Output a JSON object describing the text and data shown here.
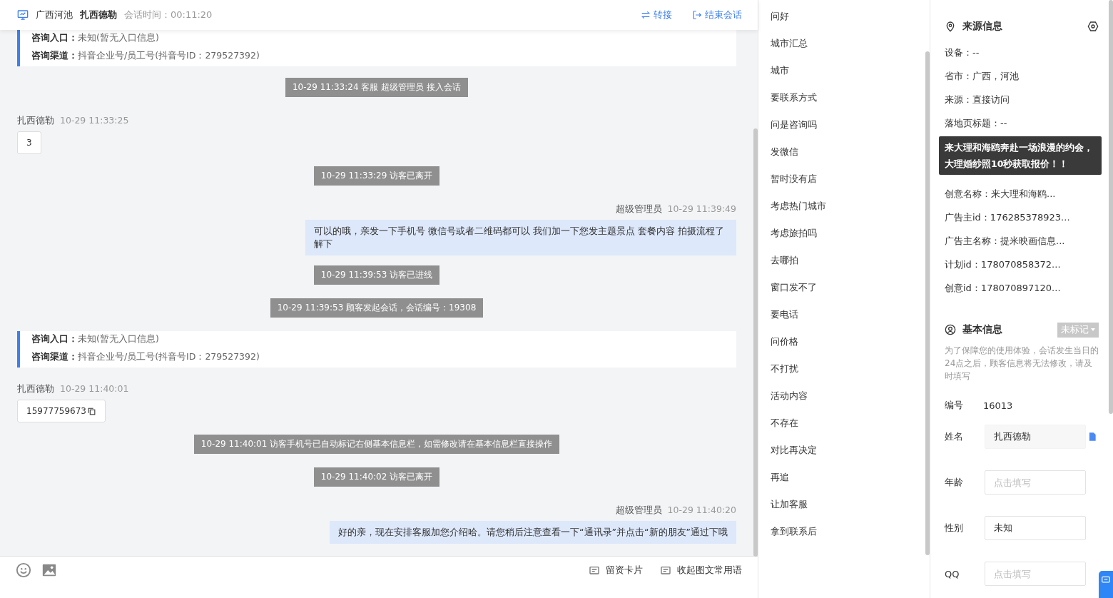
{
  "header": {
    "location": "广西河池",
    "visitor": "扎西德勒",
    "duration_label": "会话时间：",
    "duration": "00:11:20",
    "actions": [
      {
        "kind": "transfer",
        "label": "转接"
      },
      {
        "kind": "end",
        "label": "结束会话"
      }
    ]
  },
  "messages": [
    {
      "kind": "info_card",
      "rows": [
        {
          "label": "咨询入口：",
          "value": "未知(暂无入口信息)"
        },
        {
          "label": "咨询渠道：",
          "value": "抖音企业号/员工号(抖音号ID：279527392)"
        }
      ]
    },
    {
      "kind": "system",
      "text": "10-29 11:33:24 客服 超级管理员 接入会话"
    },
    {
      "kind": "visitor",
      "name": "扎西德勒",
      "time": "10-29 11:33:25",
      "text": "3"
    },
    {
      "kind": "system",
      "text": "10-29 11:33:29 访客已离开"
    },
    {
      "kind": "agent",
      "name": "超级管理员",
      "time": "10-29 11:39:49",
      "text": "可以的哦，亲发一下手机号 微信号或者二维码都可以 我们加一下您发主题景点 套餐内容 拍摄流程了解下"
    },
    {
      "kind": "system",
      "text": "10-29 11:39:53 访客已进线"
    },
    {
      "kind": "system",
      "text": "10-29 11:39:53 顾客发起会话，会话编号：19308"
    },
    {
      "kind": "info_card",
      "rows": [
        {
          "label": "咨询入口：",
          "value": "未知(暂无入口信息)"
        },
        {
          "label": "咨询渠道：",
          "value": "抖音企业号/员工号(抖音号ID：279527392)"
        }
      ]
    },
    {
      "kind": "visitor",
      "name": "扎西德勒",
      "time": "10-29 11:40:01",
      "text": "15977759673",
      "copyable": true
    },
    {
      "kind": "system",
      "text": "10-29 11:40:01 访客手机号已自动标记右侧基本信息栏，如需修改请在基本信息栏直接操作"
    },
    {
      "kind": "system",
      "text": "10-29 11:40:02 访客已离开"
    },
    {
      "kind": "agent",
      "name": "超级管理员",
      "time": "10-29 11:40:20",
      "text": "好的亲，现在安排客服加您介绍哈。请您稍后注意查看一下“通讯录”并点击“新的朋友”通过下哦"
    }
  ],
  "composer_tools": [
    {
      "kind": "emoji"
    },
    {
      "kind": "image"
    },
    {
      "kind": "card",
      "label": "留资卡片"
    },
    {
      "kind": "phrases",
      "label": "收起图文常用语"
    }
  ],
  "phrases": [
    "问好",
    "城市汇总",
    "城市",
    "要联系方式",
    "问是咨询吗",
    "发微信",
    "暂时没有店",
    "考虑热门城市",
    "考虑旅拍吗",
    "去哪拍",
    "窗口发不了",
    "要电话",
    "问价格",
    "不打扰",
    "活动内容",
    "不存在",
    "对比再决定",
    "再追",
    "让加客服",
    "拿到联系后"
  ],
  "source_info": {
    "title": "来源信息",
    "rows_before": [
      "设备：--",
      "省市：广西，河池",
      "来源：直接访问",
      "落地页标题：--"
    ],
    "tooltip": "来大理和海鸥奔赴一场浪漫的约会，大理婚纱照10秒获取报价！！",
    "rows_after": [
      "创意名称：来大理和海鸥...",
      "广告主id：176285378923...",
      "广告主名称：提米映画信息...",
      "计划id：178070858372...",
      "创意id：178070897120..."
    ]
  },
  "basic_info": {
    "title": "基本信息",
    "tag": "未标记",
    "notice": "为了保障您的使用体验，会话发生当日的24点之后，顾客信息将无法修改，请及时填写",
    "id_label": "编号",
    "id": "16013",
    "fields": [
      {
        "label": "姓名",
        "value": "扎西德勒",
        "disabled": true,
        "copyable": true
      },
      {
        "label": "年龄",
        "placeholder": "点击填写"
      },
      {
        "label": "性别",
        "value": "未知"
      },
      {
        "label": "QQ",
        "placeholder": "点击填写"
      }
    ]
  }
}
